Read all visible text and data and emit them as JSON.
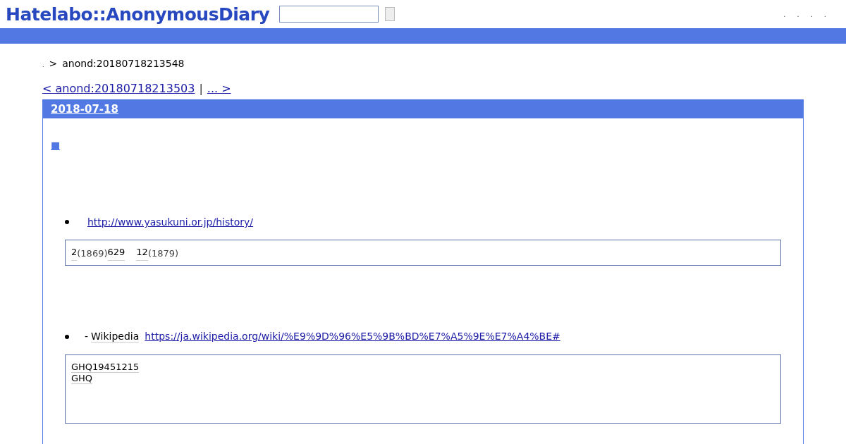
{
  "header": {
    "logo": "Hatelabo::AnonymousDiary",
    "nav_links": [
      ".",
      ".",
      ".",
      "."
    ]
  },
  "breadcrumb": {
    "home": ".",
    "separator": ">",
    "current": "anond:20180718213548"
  },
  "pager": {
    "prev": "< anond:20180718213503",
    "separator": "|",
    "next": "... >"
  },
  "entry": {
    "date": "2018-07-18",
    "section_mark": "■",
    "items": [
      {
        "link": "http://www.yasukuni.or.jp/history/",
        "quote": [
          [
            {
              "text": "2",
              "kind": "keyword"
            },
            {
              "text": "(1869)",
              "kind": "text"
            },
            {
              "text": "629",
              "kind": "keyword"
            },
            {
              "text": "12",
              "kind": "keyword"
            },
            {
              "text": "(1879)",
              "kind": "text"
            }
          ]
        ]
      },
      {
        "parts": [
          {
            "text": "- ",
            "kind": "text"
          },
          {
            "text": "Wikipedia",
            "kind": "keyword"
          }
        ],
        "link": "https://ja.wikipedia.org/wiki/%E9%9D%96%E5%9B%BD%E7%A5%9E%E7%A4%BE#",
        "quote": [
          [
            {
              "text": "GHQ19451215",
              "kind": "keyword"
            }
          ],
          [
            {
              "text": "GHQ",
              "kind": "keyword"
            }
          ]
        ]
      }
    ]
  }
}
